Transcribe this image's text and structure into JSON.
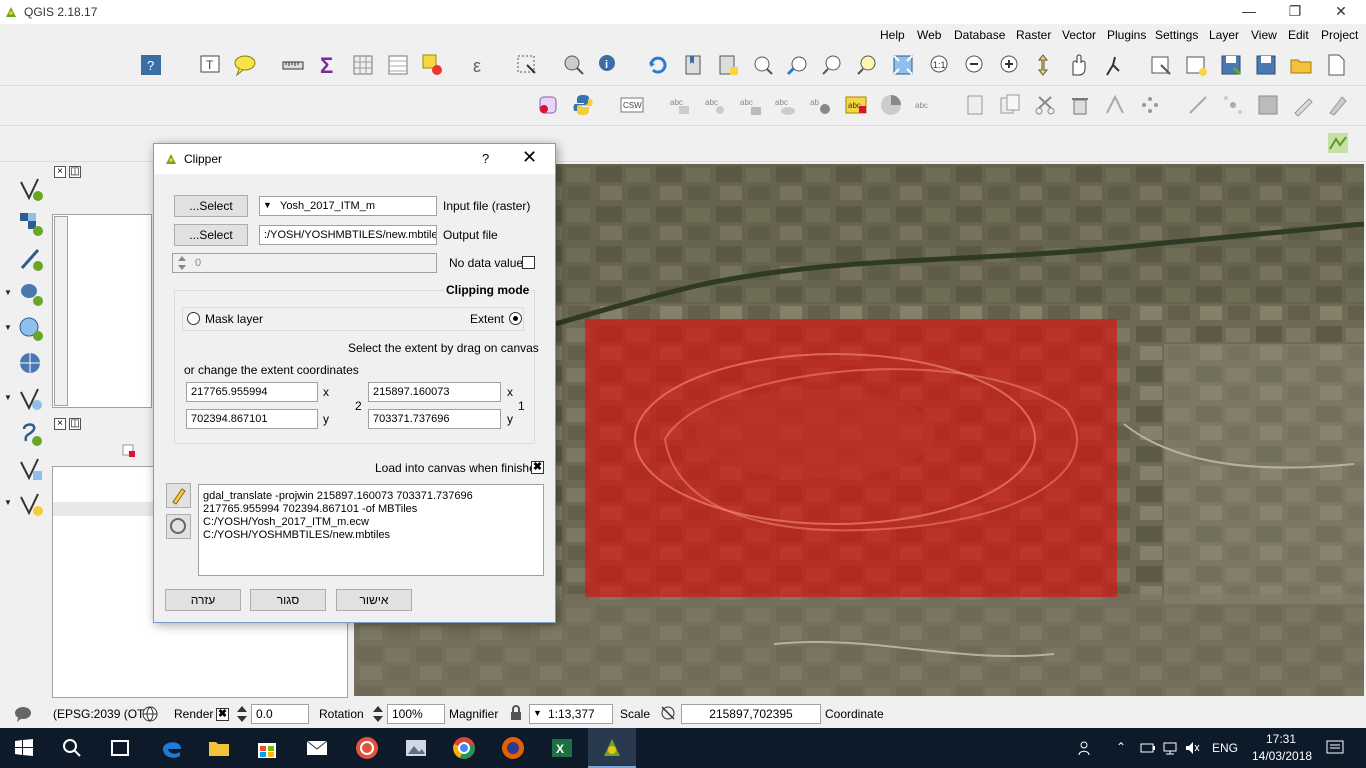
{
  "window": {
    "title": "QGIS 2.18.17"
  },
  "menus": [
    "Help",
    "Web",
    "Database",
    "Raster",
    "Vector",
    "Plugins",
    "Settings",
    "Layer",
    "View",
    "Edit",
    "Project"
  ],
  "dialog": {
    "title": "Clipper",
    "help": "?",
    "input_select_label": "...Select",
    "input_value": "Yosh_2017_ITM_m",
    "input_label": "Input file (raster)",
    "output_select_label": "...Select",
    "output_value": ":/YOSH/YOSHMBTILES/new.mbtiles",
    "output_label": "Output file",
    "nodata_value": "0",
    "nodata_label": "No data value",
    "nodata_checked": false,
    "clipping_mode_title": "Clipping mode",
    "mask_layer_label": "Mask layer",
    "extent_label": "Extent",
    "extent_selected": true,
    "drag_hint": "Select the extent by drag on canvas",
    "change_extent_label": "or change the extent coordinates",
    "x1": "217765.955994",
    "y1": "702394.867101",
    "x2": "215897.160073",
    "y2": "703371.737696",
    "x_label": "x",
    "y_label": "y",
    "point2_label": "2",
    "point1_label": "1",
    "load_canvas_label": "Load into canvas when finished",
    "load_canvas_checked": true,
    "command_lines": [
      "gdal_translate -projwin 215897.160073 703371.737696",
      "217765.955994 702394.867101 -of MBTiles",
      "C:/YOSH/Yosh_2017_ITM_m.ecw",
      "C:/YOSH/YOSHMBTILES/new.mbtiles"
    ],
    "help_button": "עזרה",
    "close_button": "סגור",
    "ok_button": "אישור"
  },
  "statusbar": {
    "crs": "(EPSG:2039 (OTF",
    "render_label": "Render",
    "render_value": "0.0",
    "rotation_label": "Rotation",
    "magnifier_value": "100%",
    "magnifier_label": "Magnifier",
    "scale_value": "1:13,377",
    "scale_label": "Scale",
    "coordinate_value": "215897,702395",
    "coordinate_label": "Coordinate"
  },
  "tray": {
    "language": "ENG",
    "time": "17:31",
    "date": "14/03/2018"
  },
  "colors": {
    "extent_fill": "#d21914",
    "taskbar": "#0c1a2a",
    "dialog_border": "#7a9cc5"
  }
}
